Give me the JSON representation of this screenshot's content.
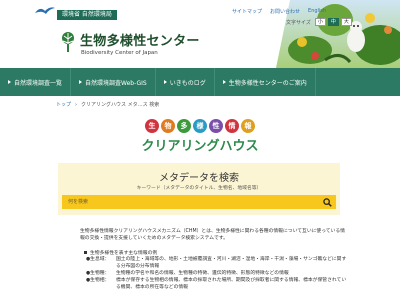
{
  "header": {
    "ministry": "環境省 自然環境局",
    "site_title": "生物多様性センター",
    "site_subtitle": "Biodiversity Center of Japan",
    "top_links": [
      "サイトマップ",
      "お問い合わせ",
      "English"
    ],
    "font_size_label": "文字サイズ",
    "font_sizes": [
      "小",
      "中",
      "大"
    ]
  },
  "nav": {
    "items": [
      "自然環境調査一覧",
      "自然環境調査Web-GIS",
      "いきものログ",
      "生物多様性センターのご案内"
    ]
  },
  "breadcrumb": {
    "home": "トップ",
    "separator": "›",
    "current": "クリアリングハウス メタ…ス 検索"
  },
  "title": {
    "chars": [
      "生",
      "物",
      "多",
      "様",
      "性",
      "情",
      "報"
    ],
    "char_colors": [
      "#d0343f",
      "#e07b1f",
      "#3a9a3c",
      "#2a9bc4",
      "#7b4fa8",
      "#d0343f",
      "#e0a01f"
    ],
    "page_title": "クリアリングハウス"
  },
  "search": {
    "heading": "メタデータを検索",
    "hint": "キーワード（メタデータのタイトル、生物名、地域名等）",
    "placeholder": "何を検索"
  },
  "description": {
    "text": "生物多様性情報クリアリングハウスメカニズム（CHM）とは、生物多様性に関わる各種の情報について互いに使っている情報の交換・提供を支援していくためのメタデータ検索システムです。",
    "list_heading": "生物多様性を表す主な情報の例",
    "items": [
      {
        "label": "●生息域：",
        "text": "国土の陸上・海域等の、地形・土地被覆調査・河川・湖沼・湿地・海岸・干潟・藻場・サンゴ礁などに関する分布図の分布情報"
      },
      {
        "label": "●生物種：",
        "text": "生物種の学名や和名の情報、生物種の特徴、遺伝的特徴、形態的特徴などの情報"
      },
      {
        "label": "●生物相：",
        "text": "標本が保存する生物相の情報、標本の採取された場所、期間及び採取者に関する情報、標本が保管されている機関、標本の所在等などの情報"
      }
    ]
  },
  "colors": {
    "brand_green": "#2c7a63",
    "title_green": "#2c8a4c",
    "search_bg": "#fbf5d4",
    "search_bar": "#f7c71d"
  },
  "icons": [
    "bird-logo-icon",
    "leaf-emblem-icon",
    "search-icon",
    "nav-bullet-icon"
  ]
}
